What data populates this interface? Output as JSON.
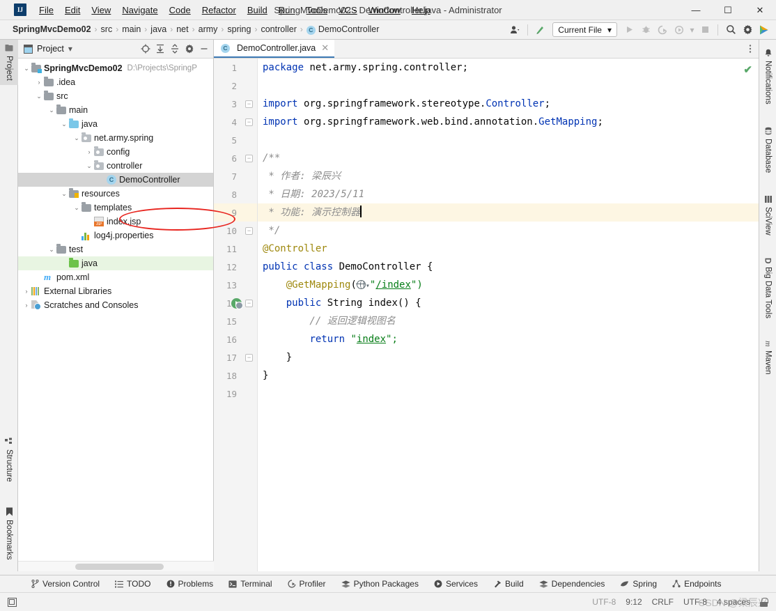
{
  "window": {
    "title": "SpringMvcDemo02 - DemoController.java - Administrator",
    "logo": "intellij-idea-logo",
    "minimize": "—",
    "maximize": "☐",
    "close": "✕"
  },
  "menubar": [
    {
      "label": "File"
    },
    {
      "label": "Edit"
    },
    {
      "label": "View"
    },
    {
      "label": "Navigate"
    },
    {
      "label": "Code"
    },
    {
      "label": "Refactor"
    },
    {
      "label": "Build"
    },
    {
      "label": "Run"
    },
    {
      "label": "Tools"
    },
    {
      "label": "VCS"
    },
    {
      "label": "Window"
    },
    {
      "label": "Help"
    }
  ],
  "navbar": {
    "breadcrumbs": [
      {
        "label": "SpringMvcDemo02",
        "bold": true
      },
      {
        "label": "src"
      },
      {
        "label": "main"
      },
      {
        "label": "java"
      },
      {
        "label": "net"
      },
      {
        "label": "army"
      },
      {
        "label": "spring"
      },
      {
        "label": "controller"
      },
      {
        "label": "DemoController",
        "icon": "C"
      }
    ],
    "separator": "›",
    "run_config": "Current File",
    "run_config_caret": "▾",
    "icons": {
      "user": "user-settings-icon",
      "updates": "update-project-icon",
      "run": "run-icon",
      "debug": "debug-icon",
      "run_coverage": "run-with-coverage-icon",
      "profile": "profile-icon",
      "stop": "stop-icon",
      "search": "search-everywhere-icon",
      "settings": "settings-gear-icon",
      "ide_extra": "ai-assistant-icon"
    }
  },
  "left_strip": [
    {
      "label": "Project",
      "icon": "project-icon",
      "active": true
    },
    {
      "label": "Structure",
      "icon": "structure-icon",
      "active": false
    },
    {
      "label": "Bookmarks",
      "icon": "bookmarks-icon",
      "active": false
    }
  ],
  "right_strip": [
    {
      "label": "Notifications",
      "icon": "bell-icon"
    },
    {
      "label": "Database",
      "icon": "database-icon"
    },
    {
      "label": "SciView",
      "icon": "sciview-icon"
    },
    {
      "label": "Big Data Tools",
      "icon": "big-data-tools-icon"
    },
    {
      "label": "Maven",
      "icon": "maven-icon"
    }
  ],
  "project_panel": {
    "title": "Project",
    "dropdown_caret": "▾",
    "header_icons": [
      {
        "name": "select-opened-file-icon",
        "glyph": "⊕"
      },
      {
        "name": "expand-all-icon",
        "glyph": "↧"
      },
      {
        "name": "collapse-all-icon",
        "glyph": "↥"
      },
      {
        "name": "panel-settings-icon",
        "glyph": "⚙"
      },
      {
        "name": "hide-panel-icon",
        "glyph": "—"
      }
    ],
    "tree": [
      {
        "label": "SpringMvcDemo02",
        "hint": "D:\\Projects\\SpringP",
        "indent": 0,
        "arrow": "⌄",
        "icon": "module-folder",
        "bold": true
      },
      {
        "label": ".idea",
        "indent": 1,
        "arrow": "›",
        "icon": "folder-gray"
      },
      {
        "label": "src",
        "indent": 1,
        "arrow": "⌄",
        "icon": "folder-gray"
      },
      {
        "label": "main",
        "indent": 2,
        "arrow": "⌄",
        "icon": "folder-gray"
      },
      {
        "label": "java",
        "indent": 3,
        "arrow": "⌄",
        "icon": "folder-blue-source"
      },
      {
        "label": "net.army.spring",
        "indent": 4,
        "arrow": "⌄",
        "icon": "package"
      },
      {
        "label": "config",
        "indent": 5,
        "arrow": "›",
        "icon": "package"
      },
      {
        "label": "controller",
        "indent": 5,
        "arrow": "⌄",
        "icon": "package"
      },
      {
        "label": "DemoController",
        "indent": 6,
        "arrow": "",
        "icon": "java-class",
        "selected": true,
        "annotated": true
      },
      {
        "label": "resources",
        "indent": 3,
        "arrow": "⌄",
        "icon": "folder-resources"
      },
      {
        "label": "templates",
        "indent": 4,
        "arrow": "⌄",
        "icon": "folder-gray"
      },
      {
        "label": "index.jsp",
        "indent": 5,
        "arrow": "",
        "icon": "jsp-file"
      },
      {
        "label": "log4j.properties",
        "indent": 4,
        "arrow": "",
        "icon": "properties-file"
      },
      {
        "label": "test",
        "indent": 2,
        "arrow": "⌄",
        "icon": "folder-gray"
      },
      {
        "label": "java",
        "indent": 3,
        "arrow": "",
        "icon": "folder-green-test",
        "highlight": true
      },
      {
        "label": "pom.xml",
        "indent": 1,
        "arrow": "",
        "icon": "maven-file"
      },
      {
        "label": "External Libraries",
        "indent": 0,
        "arrow": "›",
        "icon": "libraries"
      },
      {
        "label": "Scratches and Consoles",
        "indent": 0,
        "arrow": "›",
        "icon": "scratches"
      }
    ]
  },
  "editor": {
    "tab": {
      "label": "DemoController.java",
      "icon": "C",
      "close": "✕"
    },
    "tab_menu_icon": "more-options-icon",
    "inspection_status": "✔",
    "lines": [
      {
        "n": 1,
        "fold": "",
        "tokens": [
          {
            "t": "package ",
            "c": "kw"
          },
          {
            "t": "net.army.spring.controller;",
            "c": "plain"
          }
        ]
      },
      {
        "n": 2,
        "fold": "",
        "tokens": []
      },
      {
        "n": 3,
        "fold": "top",
        "tokens": [
          {
            "t": "import ",
            "c": "kw"
          },
          {
            "t": "org.springframework.stereotype.",
            "c": "plain"
          },
          {
            "t": "Controller",
            "c": "kw"
          },
          {
            "t": ";",
            "c": "plain"
          }
        ]
      },
      {
        "n": 4,
        "fold": "bot",
        "tokens": [
          {
            "t": "import ",
            "c": "kw"
          },
          {
            "t": "org.springframework.web.bind.annotation.",
            "c": "plain"
          },
          {
            "t": "GetMapping",
            "c": "kw"
          },
          {
            "t": ";",
            "c": "plain"
          }
        ]
      },
      {
        "n": 5,
        "fold": "",
        "tokens": []
      },
      {
        "n": 6,
        "fold": "top",
        "tokens": [
          {
            "t": "/**",
            "c": "cmt"
          }
        ]
      },
      {
        "n": 7,
        "fold": "",
        "tokens": [
          {
            "t": " * 作者: 梁辰兴",
            "c": "cmt"
          }
        ]
      },
      {
        "n": 8,
        "fold": "",
        "tokens": [
          {
            "t": " * 日期: 2023/5/11",
            "c": "cmt"
          }
        ]
      },
      {
        "n": 9,
        "fold": "",
        "highlight": true,
        "caret": true,
        "tokens": [
          {
            "t": " * 功能: 演示控制器",
            "c": "cmt"
          }
        ]
      },
      {
        "n": 10,
        "fold": "bot",
        "tokens": [
          {
            "t": " */",
            "c": "cmt"
          }
        ]
      },
      {
        "n": 11,
        "fold": "",
        "tokens": [
          {
            "t": "@Controller",
            "c": "ann"
          }
        ]
      },
      {
        "n": 12,
        "fold": "",
        "tokens": [
          {
            "t": "public class ",
            "c": "kw"
          },
          {
            "t": "DemoController {",
            "c": "plain"
          }
        ]
      },
      {
        "n": 13,
        "fold": "",
        "tokens": [
          {
            "t": "    ",
            "c": "plain"
          },
          {
            "t": "@GetMapping",
            "c": "ann"
          },
          {
            "t": "(",
            "c": "plain"
          },
          {
            "t": "GLOBE",
            "c": "globe"
          },
          {
            "t": "\"",
            "c": "str"
          },
          {
            "t": "/index",
            "c": "str-ul"
          },
          {
            "t": "\")",
            "c": "str"
          }
        ]
      },
      {
        "n": 14,
        "fold": "top",
        "gutter_icon": "run-method-icon",
        "tokens": [
          {
            "t": "    ",
            "c": "plain"
          },
          {
            "t": "public ",
            "c": "kw"
          },
          {
            "t": "String ",
            "c": "plain"
          },
          {
            "t": "index",
            "c": "plain"
          },
          {
            "t": "() {",
            "c": "plain"
          }
        ]
      },
      {
        "n": 15,
        "fold": "",
        "tokens": [
          {
            "t": "        // 返回逻辑视图名",
            "c": "cmt"
          }
        ]
      },
      {
        "n": 16,
        "fold": "",
        "tokens": [
          {
            "t": "        ",
            "c": "plain"
          },
          {
            "t": "return ",
            "c": "kw"
          },
          {
            "t": "\"",
            "c": "str"
          },
          {
            "t": "index",
            "c": "str-ul"
          },
          {
            "t": "\";",
            "c": "str"
          }
        ]
      },
      {
        "n": 17,
        "fold": "bot",
        "tokens": [
          {
            "t": "    }",
            "c": "plain"
          }
        ]
      },
      {
        "n": 18,
        "fold": "",
        "tokens": [
          {
            "t": "}",
            "c": "plain"
          }
        ]
      },
      {
        "n": 19,
        "fold": "",
        "tokens": []
      }
    ]
  },
  "bottom_tabs": [
    {
      "label": "Version Control",
      "icon": "branch-icon"
    },
    {
      "label": "TODO",
      "icon": "list-icon"
    },
    {
      "label": "Problems",
      "icon": "warning-circle-icon"
    },
    {
      "label": "Terminal",
      "icon": "terminal-icon"
    },
    {
      "label": "Profiler",
      "icon": "profiler-icon"
    },
    {
      "label": "Python Packages",
      "icon": "packages-icon"
    },
    {
      "label": "Services",
      "icon": "services-play-icon"
    },
    {
      "label": "Build",
      "icon": "hammer-icon"
    },
    {
      "label": "Dependencies",
      "icon": "layers-icon"
    },
    {
      "label": "Spring",
      "icon": "spring-leaf-icon"
    },
    {
      "label": "Endpoints",
      "icon": "endpoints-icon"
    }
  ],
  "statusbar": {
    "left_icon": "show-tool-windows-icon",
    "encoding": "UTF-8",
    "caret_position": "9:12",
    "line_separator": "CRLF",
    "encoding_right": "UTF-8",
    "indent": "4 spaces",
    "lock_icon": "read-only-lock-icon",
    "watermark": "CSDN @梁辰兴"
  }
}
